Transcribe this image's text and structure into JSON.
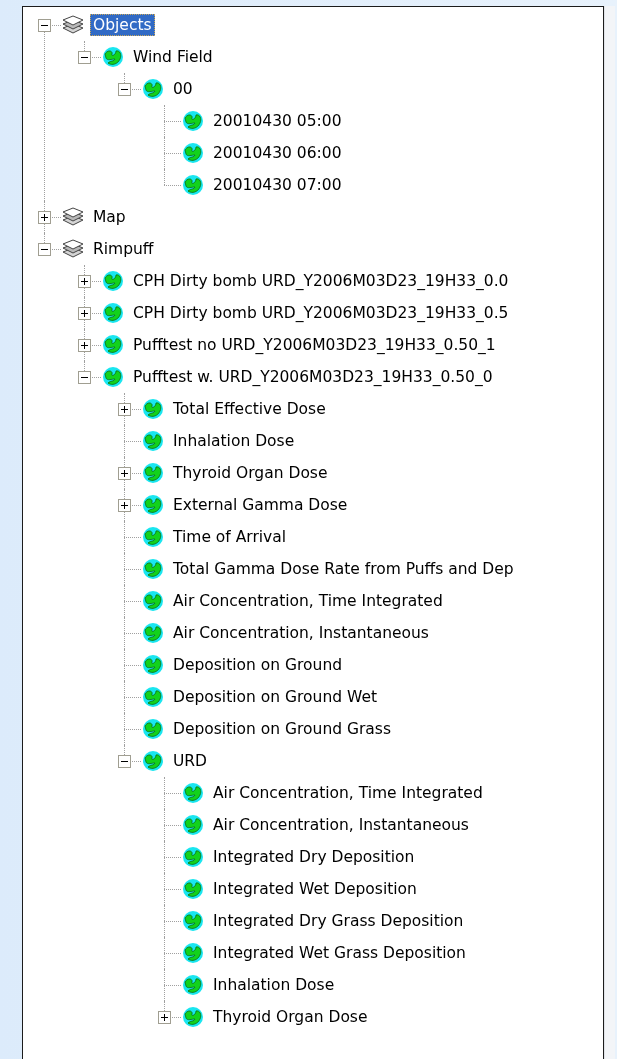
{
  "tree": [
    {
      "label": "Objects",
      "kind": "group",
      "selected": true,
      "expanded": true,
      "children": [
        {
          "label": "Wind Field",
          "kind": "dataset",
          "selected": false,
          "expanded": true,
          "children": [
            {
              "label": "00",
              "kind": "dataset",
              "selected": false,
              "expanded": true,
              "children": [
                {
                  "label": "20010430 05:00",
                  "kind": "dataset",
                  "selected": false
                },
                {
                  "label": "20010430 06:00",
                  "kind": "dataset",
                  "selected": false
                },
                {
                  "label": "20010430 07:00",
                  "kind": "dataset",
                  "selected": false
                }
              ]
            }
          ]
        }
      ]
    },
    {
      "label": "Map",
      "kind": "group",
      "selected": false,
      "expanded": false
    },
    {
      "label": "Rimpuff",
      "kind": "group",
      "selected": false,
      "expanded": true,
      "children": [
        {
          "label": "CPH Dirty bomb URD_Y2006M03D23_19H33_0.0",
          "kind": "dataset",
          "selected": false,
          "expanded": false
        },
        {
          "label": "CPH Dirty bomb URD_Y2006M03D23_19H33_0.5",
          "kind": "dataset",
          "selected": false,
          "expanded": false
        },
        {
          "label": "Pufftest no URD_Y2006M03D23_19H33_0.50_1",
          "kind": "dataset",
          "selected": false,
          "expanded": false
        },
        {
          "label": "Pufftest w. URD_Y2006M03D23_19H33_0.50_0",
          "kind": "dataset",
          "selected": false,
          "expanded": true,
          "children": [
            {
              "label": "Total Effective Dose",
              "kind": "dataset",
              "selected": false,
              "expanded": false
            },
            {
              "label": "Inhalation Dose",
              "kind": "dataset",
              "selected": false
            },
            {
              "label": "Thyroid Organ Dose",
              "kind": "dataset",
              "selected": false,
              "expanded": false
            },
            {
              "label": "External Gamma Dose",
              "kind": "dataset",
              "selected": false,
              "expanded": false
            },
            {
              "label": "Time of Arrival",
              "kind": "dataset",
              "selected": false
            },
            {
              "label": "Total Gamma Dose Rate from Puffs and Dep",
              "kind": "dataset",
              "selected": false
            },
            {
              "label": "Air Concentration, Time Integrated",
              "kind": "dataset",
              "selected": false
            },
            {
              "label": "Air Concentration, Instantaneous",
              "kind": "dataset",
              "selected": false
            },
            {
              "label": "Deposition on Ground",
              "kind": "dataset",
              "selected": false
            },
            {
              "label": "Deposition on Ground Wet",
              "kind": "dataset",
              "selected": false
            },
            {
              "label": "Deposition on Ground Grass",
              "kind": "dataset",
              "selected": false
            },
            {
              "label": "URD",
              "kind": "dataset",
              "selected": false,
              "expanded": true,
              "children": [
                {
                  "label": "Air Concentration, Time Integrated",
                  "kind": "dataset",
                  "selected": false
                },
                {
                  "label": "Air Concentration, Instantaneous",
                  "kind": "dataset",
                  "selected": false
                },
                {
                  "label": "Integrated Dry Deposition",
                  "kind": "dataset",
                  "selected": false
                },
                {
                  "label": "Integrated Wet Deposition",
                  "kind": "dataset",
                  "selected": false
                },
                {
                  "label": "Integrated Dry Grass Deposition",
                  "kind": "dataset",
                  "selected": false
                },
                {
                  "label": "Integrated Wet Grass Deposition",
                  "kind": "dataset",
                  "selected": false
                },
                {
                  "label": "Inhalation Dose",
                  "kind": "dataset",
                  "selected": false
                },
                {
                  "label": "Thyroid Organ Dose",
                  "kind": "dataset",
                  "selected": false,
                  "expanded": false
                }
              ]
            }
          ]
        }
      ]
    }
  ]
}
